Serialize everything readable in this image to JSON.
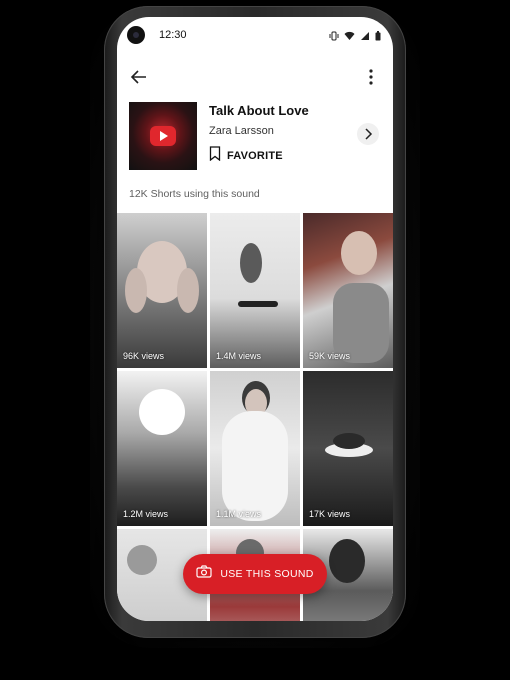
{
  "status_bar": {
    "time": "12:30"
  },
  "sound": {
    "title": "Talk About Love",
    "artist": "Zara Larsson",
    "favorite_label": "FAVORITE",
    "shorts_count": "12K Shorts using this sound"
  },
  "shorts": [
    {
      "views": "96K views"
    },
    {
      "views": "1.4M views"
    },
    {
      "views": "59K views"
    },
    {
      "views": "1.2M views"
    },
    {
      "views": "1.1M views"
    },
    {
      "views": "17K views"
    },
    {
      "views": ""
    },
    {
      "views": ""
    },
    {
      "views": ""
    }
  ],
  "cta": {
    "label": "USE THIS SOUND"
  },
  "colors": {
    "accent": "#d81f26",
    "screen_bg": "#ffffff",
    "frame": "#2a2a2a"
  },
  "icons": [
    "back-arrow-icon",
    "more-vert-icon",
    "bookmark-icon",
    "chevron-right-icon",
    "camera-icon",
    "vibrate-icon",
    "wifi-icon",
    "signal-icon",
    "battery-icon",
    "play-icon"
  ]
}
